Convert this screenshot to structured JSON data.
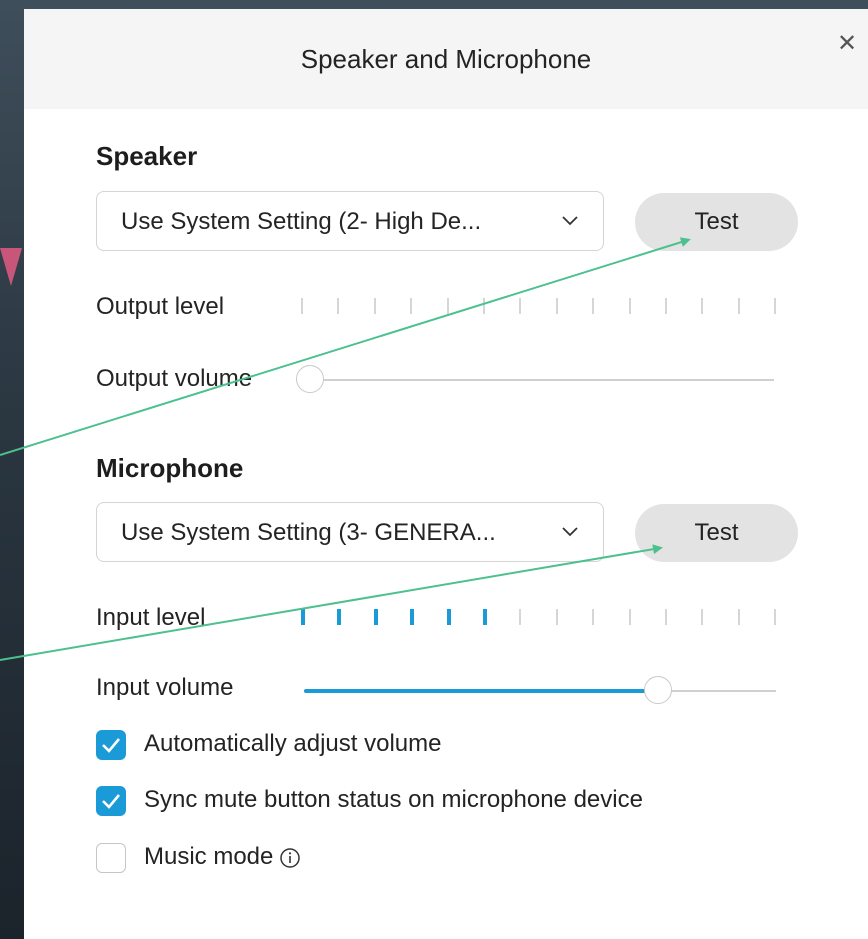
{
  "dialog": {
    "title": "Speaker and Microphone",
    "close_icon": "close-icon"
  },
  "speaker": {
    "heading": "Speaker",
    "device": "Use System Setting (2- High De...",
    "test_label": "Test",
    "output_level_label": "Output level",
    "output_level_active_ticks": 0,
    "output_level_total_ticks": 14,
    "output_volume_label": "Output volume",
    "output_volume_fraction": 0.0
  },
  "microphone": {
    "heading": "Microphone",
    "device": "Use System Setting (3- GENERA...",
    "test_label": "Test",
    "input_level_label": "Input level",
    "input_level_active_ticks": 6,
    "input_level_total_ticks": 14,
    "input_volume_label": "Input volume",
    "input_volume_fraction": 0.75
  },
  "options": {
    "auto_adjust": {
      "label": "Automatically adjust volume",
      "checked": true
    },
    "sync_mute": {
      "label": "Sync mute button status on microphone device",
      "checked": true
    },
    "music_mode": {
      "label": "Music mode",
      "checked": false,
      "icon": "info-icon"
    }
  },
  "colors": {
    "accent": "#1a9ad6",
    "annotation_arrow": "#4cc08f",
    "background_arrow": "#c8557a"
  }
}
